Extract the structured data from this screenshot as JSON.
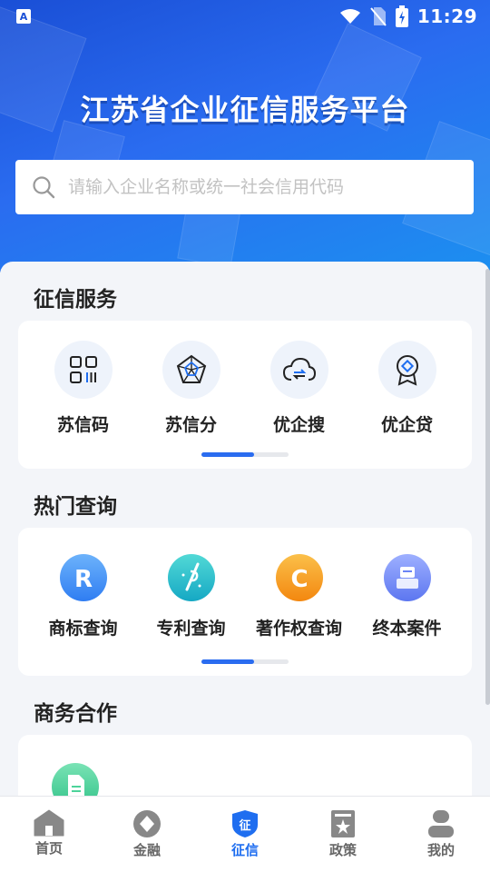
{
  "status_bar": {
    "time": "11:29",
    "app_icon_letter": "A"
  },
  "header": {
    "title": "江苏省企业征信服务平台",
    "search_placeholder": "请输入企业名称或统一社会信用代码"
  },
  "sections": {
    "credit_services": {
      "title": "征信服务",
      "items": [
        {
          "label": "苏信码",
          "icon": "grid-code-icon"
        },
        {
          "label": "苏信分",
          "icon": "radar-chart-icon"
        },
        {
          "label": "优企搜",
          "icon": "cloud-search-icon"
        },
        {
          "label": "优企贷",
          "icon": "medal-icon"
        }
      ],
      "pager_active_fraction": 0.6
    },
    "hot_queries": {
      "title": "热门查询",
      "items": [
        {
          "label": "商标查询",
          "icon": "trademark-icon",
          "color": "#3d8ff5",
          "glyph": "R"
        },
        {
          "label": "专利查询",
          "icon": "patent-icon",
          "color": "#1fb8c8"
        },
        {
          "label": "著作权查询",
          "icon": "copyright-icon",
          "color": "#f59a1a",
          "glyph": "C"
        },
        {
          "label": "终本案件",
          "icon": "case-icon",
          "color": "#6a84f5"
        }
      ],
      "pager_active_fraction": 0.6
    },
    "business": {
      "title": "商务合作",
      "items": [
        {
          "icon": "document-icon",
          "color": "#4dd39a"
        }
      ]
    }
  },
  "tabbar": {
    "active": "征信",
    "tabs": [
      {
        "label": "首页",
        "icon": "home-icon"
      },
      {
        "label": "金融",
        "icon": "finance-icon"
      },
      {
        "label": "征信",
        "icon": "credit-badge-icon",
        "badge_text": "征"
      },
      {
        "label": "政策",
        "icon": "policy-icon"
      },
      {
        "label": "我的",
        "icon": "profile-icon"
      }
    ]
  },
  "colors": {
    "accent": "#1f6ef0",
    "hero_start": "#1a4fd6",
    "hero_end": "#1c8ff0"
  }
}
